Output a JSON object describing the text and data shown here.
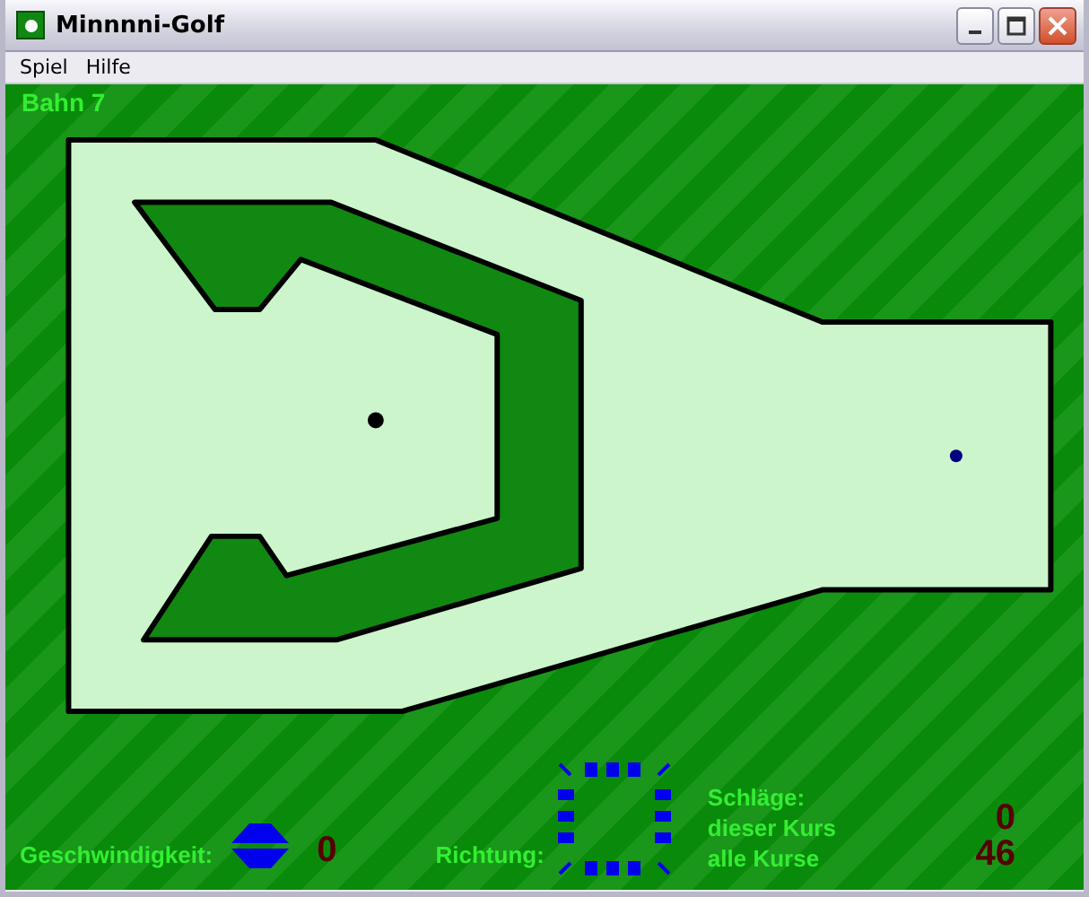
{
  "window": {
    "title": "Minnnni-Golf"
  },
  "menu": [
    "Spiel",
    "Hilfe"
  ],
  "course": {
    "label": "Bahn 7"
  },
  "speed": {
    "label": "Geschwindigkeit:",
    "value": "0"
  },
  "direction": {
    "label": "Richtung:"
  },
  "strokes": {
    "label": "Schläge:",
    "rows": [
      {
        "label": "dieser Kurs",
        "value": "0"
      },
      {
        "label": "alle Kurse",
        "value": "46"
      }
    ]
  }
}
